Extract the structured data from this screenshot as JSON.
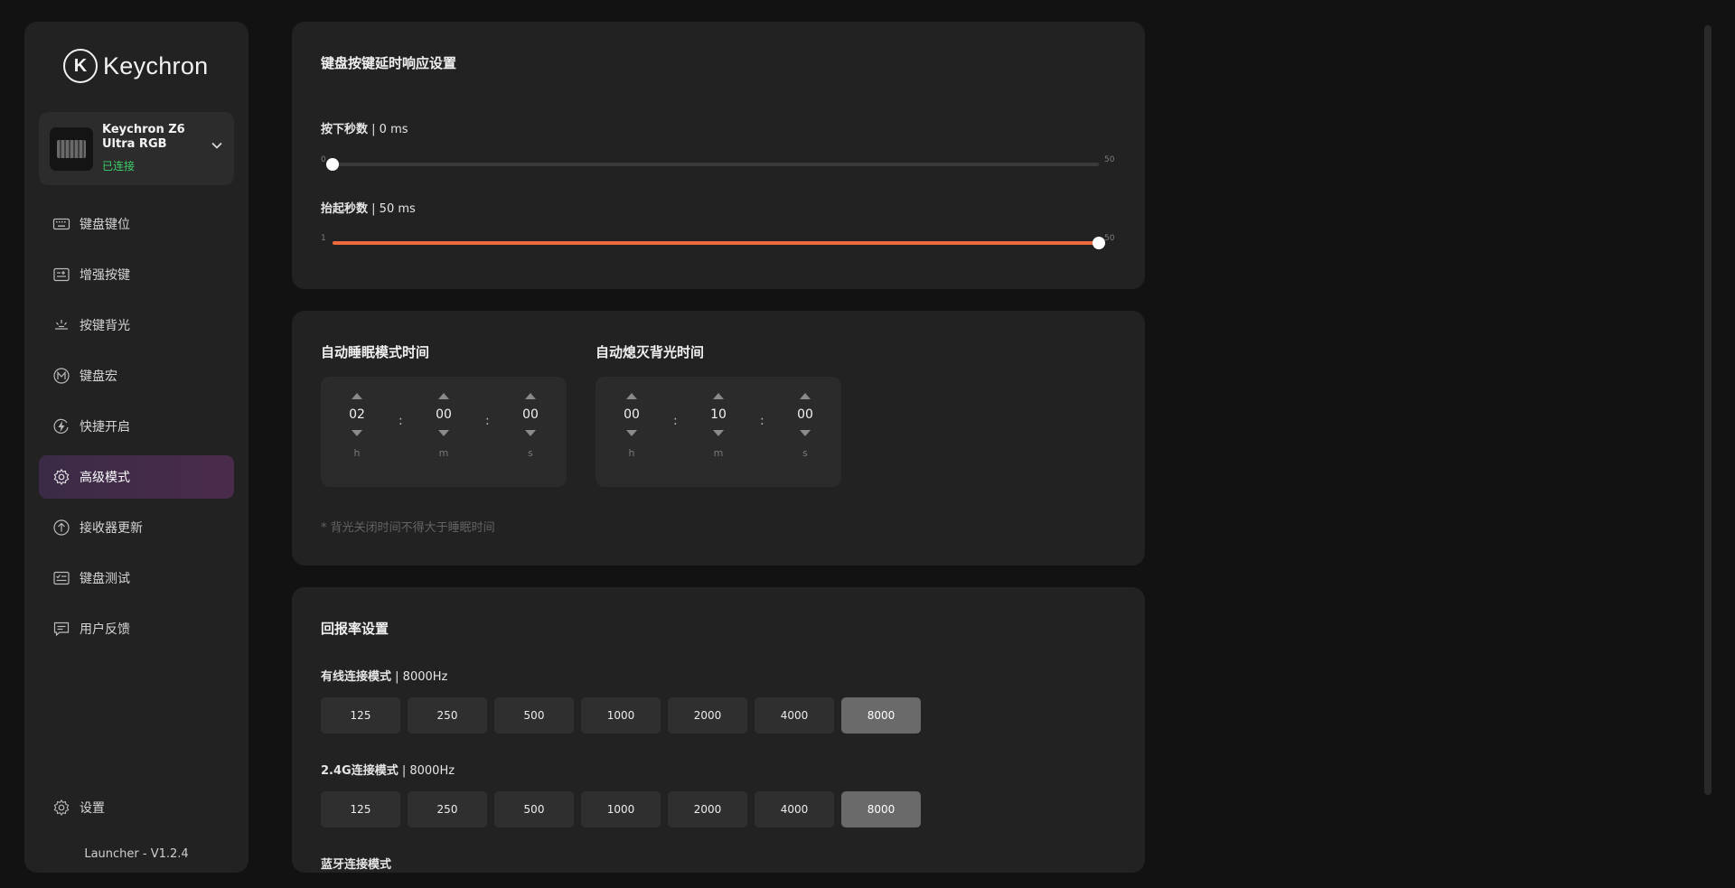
{
  "app": {
    "brand": "Keychron",
    "logo_letter": "K",
    "version": "Launcher - V1.2.4"
  },
  "device": {
    "name": "Keychron Z6 Ultra RGB",
    "status": "已连接"
  },
  "nav": {
    "items": [
      {
        "label": "键盘键位",
        "icon": "keyboard-icon"
      },
      {
        "label": "增强按键",
        "icon": "enhanced-key-icon"
      },
      {
        "label": "按键背光",
        "icon": "backlight-icon"
      },
      {
        "label": "键盘宏",
        "icon": "macro-icon"
      },
      {
        "label": "快捷开启",
        "icon": "quick-launch-icon"
      },
      {
        "label": "高级模式",
        "icon": "gear-icon",
        "active": true
      },
      {
        "label": "接收器更新",
        "icon": "upload-icon"
      },
      {
        "label": "键盘测试",
        "icon": "keyboard-test-icon"
      },
      {
        "label": "用户反馈",
        "icon": "feedback-icon"
      }
    ],
    "settings_label": "设置"
  },
  "debounce": {
    "title": "键盘按键延时响应设置",
    "press": {
      "label": "按下秒数",
      "value_text": "0 ms",
      "min": 0,
      "max": 50,
      "value": 0,
      "min_label": "0",
      "max_label": "50"
    },
    "release": {
      "label": "抬起秒数",
      "value_text": "50 ms",
      "min": 1,
      "max": 50,
      "value": 50,
      "min_label": "1",
      "max_label": "50"
    }
  },
  "sleep": {
    "sleep_title": "自动睡眠模式时间",
    "sleep_time": {
      "h": "02",
      "m": "00",
      "s": "00"
    },
    "backlight_title": "自动熄灭背光时间",
    "backlight_time": {
      "h": "00",
      "m": "10",
      "s": "00"
    },
    "units": {
      "h": "h",
      "m": "m",
      "s": "s"
    },
    "colon": ":",
    "note": "* 背光关闭时间不得大于睡眠时间"
  },
  "polling": {
    "title": "回报率设置",
    "wired": {
      "label": "有线连接模式",
      "value_text": "8000Hz",
      "options": [
        "125",
        "250",
        "500",
        "1000",
        "2000",
        "4000",
        "8000"
      ],
      "selected": "8000"
    },
    "wireless": {
      "label": "2.4G连接模式",
      "value_text": "8000Hz",
      "options": [
        "125",
        "250",
        "500",
        "1000",
        "2000",
        "4000",
        "8000"
      ],
      "selected": "8000"
    },
    "bluetooth": {
      "label": "蓝牙连接模式"
    }
  },
  "colors": {
    "accent": "#ee6a3d",
    "connected": "#3fcf6b",
    "active_nav": "#4a2b4c"
  }
}
